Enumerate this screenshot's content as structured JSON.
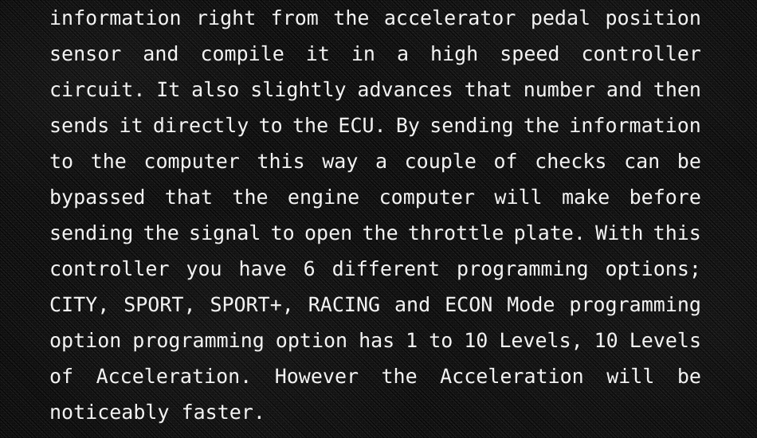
{
  "panel": {
    "background_color": "#141414",
    "text_color": "#f2f2f2",
    "texture": "dark-woven-carbon-fiber-diagonal",
    "alignment": "justified",
    "font_style": "monospace"
  },
  "description": {
    "full_text": "information right from the accelerator pedal position sensor and compile it in a high speed controller circuit. It also slightly advances that number and then sends it directly to the ECU. By sending the information to the computer this way a couple of checks can be bypassed that the engine computer will make before sending the signal to open the throttle plate. With this controller you have 6 different programming options; CITY, SPORT, SPORT+, RACING and ECON Mode programming option programming option has 1 to 10 Levels, 10 Levels of Acceleration. However the Acceleration will be noticeably faster.",
    "lines": [
      {
        "index": 1,
        "align": "justify",
        "text": "information right from the accelerator pedal position",
        "words": [
          "information",
          "right",
          "from",
          "the",
          "accelerator",
          "pedal",
          "position"
        ]
      },
      {
        "index": 2,
        "align": "justify",
        "text": "sensor and compile it in a high speed controller",
        "words": [
          "sensor",
          "and",
          "compile",
          "it",
          "in",
          "a",
          "high",
          "speed",
          "controller"
        ]
      },
      {
        "index": 3,
        "align": "justify",
        "text": "circuit. It also slightly advances that number and then",
        "words": [
          "circuit.",
          "It",
          "also",
          "slightly",
          "advances",
          "that",
          "number",
          "and",
          "then"
        ]
      },
      {
        "index": 4,
        "align": "justify",
        "text": "sends it directly to the ECU. By sending the information",
        "words": [
          "sends",
          "it",
          "directly",
          "to",
          "the",
          "ECU.",
          "By",
          "sending",
          "the",
          "information"
        ]
      },
      {
        "index": 5,
        "align": "justify",
        "text": "to the computer this way a couple of checks can be",
        "words": [
          "to",
          "the",
          "computer",
          "this",
          "way",
          "a",
          "couple",
          "of",
          "checks",
          "can",
          "be"
        ]
      },
      {
        "index": 6,
        "align": "justify",
        "text": "bypassed that the engine computer will make before",
        "words": [
          "bypassed",
          "that",
          "the",
          "engine",
          "computer",
          "will",
          "make",
          "before"
        ]
      },
      {
        "index": 7,
        "align": "justify",
        "text": "sending the signal to open the throttle plate. With this",
        "words": [
          "sending",
          "the",
          "signal",
          "to",
          "open",
          "the",
          "throttle",
          "plate.",
          "With",
          "this"
        ]
      },
      {
        "index": 8,
        "align": "justify",
        "text": "controller you have 6 different programming options;",
        "words": [
          "controller",
          "you",
          "have",
          "6",
          "different",
          "programming",
          "options;"
        ]
      },
      {
        "index": 9,
        "align": "justify",
        "text": "CITY, SPORT, SPORT+, RACING and ECON Mode programming",
        "words": [
          "CITY,",
          "SPORT,",
          "SPORT+,",
          "RACING",
          "and",
          "ECON",
          "Mode",
          "programming"
        ]
      },
      {
        "index": 10,
        "align": "justify",
        "text": "option programming option has 1 to 10 Levels, 10 Levels",
        "words": [
          "option",
          "programming",
          "option",
          "has",
          "1",
          "to",
          "10",
          "Levels,",
          "10",
          "Levels"
        ]
      },
      {
        "index": 11,
        "align": "justify",
        "text": "of Acceleration. However the Acceleration will be",
        "words": [
          "of",
          "Acceleration.",
          "However",
          "the",
          "Acceleration",
          "will",
          "be"
        ]
      },
      {
        "index": 12,
        "align": "left",
        "text": "noticeably faster.",
        "words": [
          "noticeably faster."
        ]
      }
    ]
  },
  "keywords": {
    "modes": [
      "CITY",
      "SPORT",
      "SPORT+",
      "RACING",
      "ECON Mode"
    ],
    "mode_count": "6",
    "levels_range": "1 to 10 Levels",
    "levels_count": "10 Levels",
    "components": [
      "accelerator pedal position sensor",
      "high speed controller circuit",
      "ECU",
      "throttle plate"
    ]
  }
}
